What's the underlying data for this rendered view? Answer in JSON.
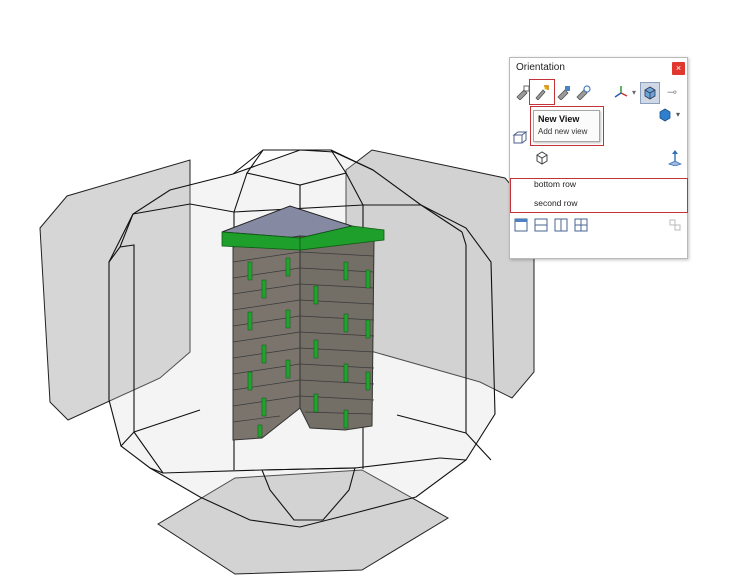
{
  "panel": {
    "title": "Orientation",
    "close_glyph": "×"
  },
  "toolbar": {
    "items": [
      {
        "name": "pin-views-icon"
      },
      {
        "name": "new-view-icon",
        "highlighted": true
      },
      {
        "name": "update-standard-views-icon"
      },
      {
        "name": "reset-standard-views-icon"
      },
      {
        "name": "axes-triad-icon"
      },
      {
        "name": "dropdown-caret-icon"
      },
      {
        "name": "view-cube-toggle-icon",
        "pressed": true
      },
      {
        "name": "pin-icon"
      }
    ]
  },
  "tooltip": {
    "title": "New View",
    "subtitle": "Add new view"
  },
  "views": {
    "items": [
      "bottom row",
      "second row"
    ]
  },
  "colors": {
    "highlight": "#c4323a",
    "close_button": "#e0372e",
    "wall_brick": "#78736b",
    "wall_trim": "#1e9e2a",
    "cap_top": "#858aa2",
    "glass": "#d2d2d2"
  }
}
